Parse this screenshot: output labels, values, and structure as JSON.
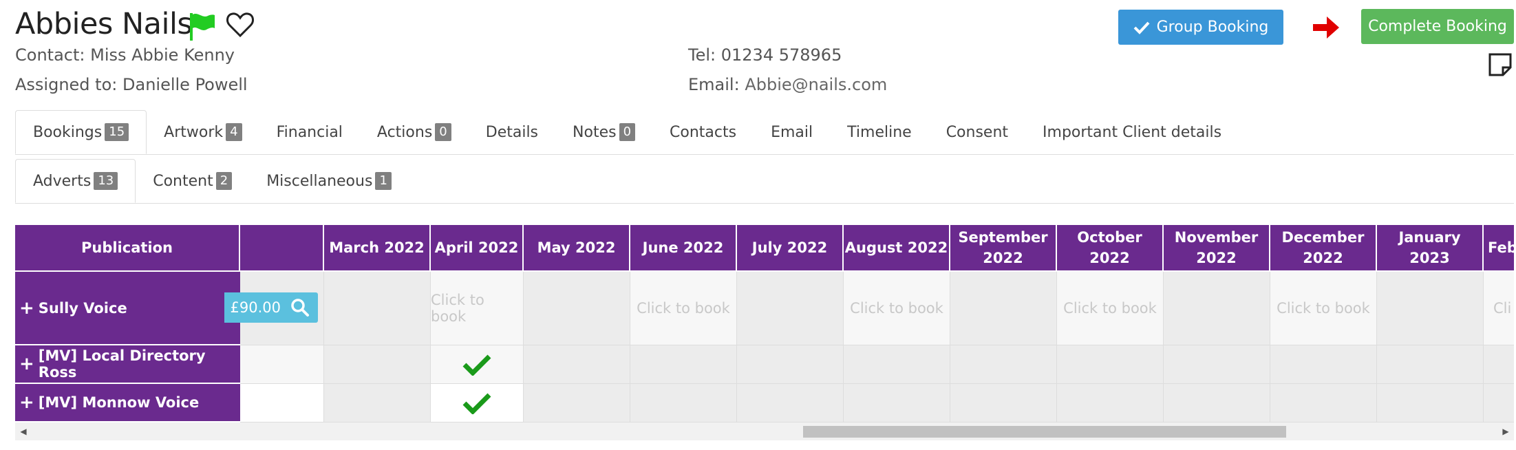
{
  "client": {
    "name": "Abbies Nails",
    "contact_label": "Contact:",
    "contact_value": "Miss Abbie Kenny",
    "assigned_label": "Assigned to:",
    "assigned_value": "Danielle Powell",
    "tel_label": "Tel:",
    "tel_value": "01234 578965",
    "email_label": "Email:",
    "email_value": "Abbie@nails.com",
    "flag_color": "#22cc22"
  },
  "actions": {
    "group_booking": "Group Booking",
    "complete_booking": "Complete Booking"
  },
  "main_tabs": [
    {
      "label": "Bookings",
      "badge": "15"
    },
    {
      "label": "Artwork",
      "badge": "4"
    },
    {
      "label": "Financial",
      "badge": ""
    },
    {
      "label": "Actions",
      "badge": "0"
    },
    {
      "label": "Details",
      "badge": ""
    },
    {
      "label": "Notes",
      "badge": "0"
    },
    {
      "label": "Contacts",
      "badge": ""
    },
    {
      "label": "Email",
      "badge": ""
    },
    {
      "label": "Timeline",
      "badge": ""
    },
    {
      "label": "Consent",
      "badge": ""
    },
    {
      "label": "Important Client details",
      "badge": ""
    }
  ],
  "sub_tabs": [
    {
      "label": "Adverts",
      "badge": "13"
    },
    {
      "label": "Content",
      "badge": "2"
    },
    {
      "label": "Miscellaneous",
      "badge": "1"
    }
  ],
  "grid": {
    "publication_header": "Publication",
    "months": [
      "March 2022",
      "April 2022",
      "May 2022",
      "June 2022",
      "July 2022",
      "August 2022",
      "September 2022",
      "October 2022",
      "November 2022",
      "December 2022",
      "January 2023",
      "Feb"
    ],
    "click_to_book": "Click to book",
    "click_to_book_partial": "Cli",
    "price": "£90.00",
    "rows": [
      {
        "name": "Sully Voice"
      },
      {
        "name": "[MV] Local Directory Ross"
      },
      {
        "name": "[MV] Monnow Voice"
      }
    ]
  },
  "colors": {
    "header_purple": "#6a2a8e",
    "group_btn": "#3a96d8",
    "complete_btn": "#5cb85c",
    "check_green": "#1a9a1a",
    "arrow_red": "#e00000"
  }
}
